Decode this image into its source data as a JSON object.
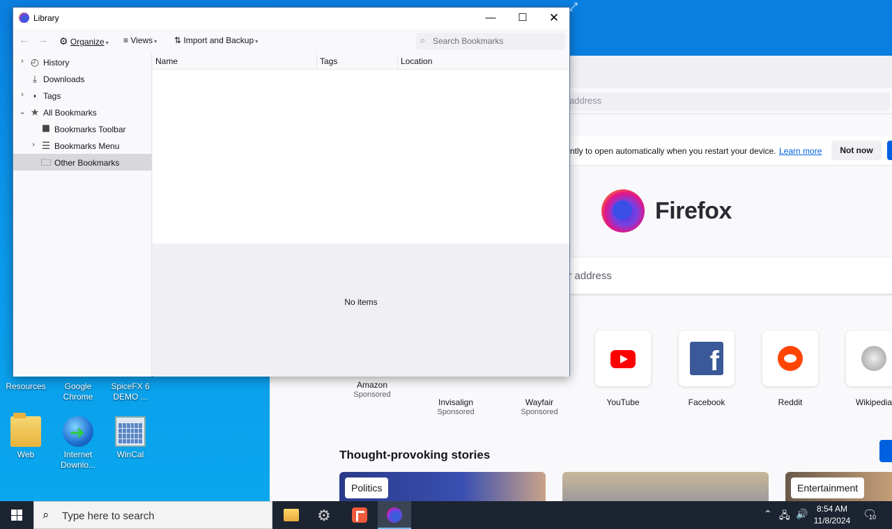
{
  "desktop": {
    "icons": [
      {
        "label": "Resources"
      },
      {
        "label": "Google Chrome"
      },
      {
        "label": "SpiceFX 6 DEMO ..."
      },
      {
        "label": "Web"
      },
      {
        "label": "Internet Downlo..."
      },
      {
        "label": "WinCal"
      }
    ]
  },
  "firefox": {
    "url_placeholder": "address",
    "notice": {
      "message": "ntly to open automatically when you restart your device.",
      "learn_more": "Learn more",
      "not_now": "Not now"
    },
    "wordmark": "Firefox",
    "search_placeholder": "er address",
    "shortcuts": [
      {
        "label": "Amazon",
        "sponsored": "Sponsored"
      },
      {
        "label": "Invisalign",
        "sponsored": "Sponsored"
      },
      {
        "label": "Wayfair",
        "sponsored": "Sponsored"
      },
      {
        "label": "YouTube",
        "icon": "youtube-icon"
      },
      {
        "label": "Facebook",
        "icon": "facebook-icon"
      },
      {
        "label": "Reddit",
        "icon": "reddit-icon"
      },
      {
        "label": "Wikipedia",
        "icon": "wikipedia-icon"
      }
    ],
    "stories_title": "Thought-provoking stories",
    "stories": [
      {
        "tag": "Politics"
      },
      {
        "tag": "Entertainment"
      }
    ]
  },
  "library": {
    "title": "Library",
    "toolbar": {
      "organize": "Organize",
      "views": "Views",
      "import_backup": "Import and Backup",
      "search_placeholder": "Search Bookmarks"
    },
    "tree": [
      {
        "label": "History",
        "icon": "clock-icon",
        "expander": "collapsed"
      },
      {
        "label": "Downloads",
        "icon": "download-icon",
        "expander": "none"
      },
      {
        "label": "Tags",
        "icon": "tag-icon",
        "expander": "collapsed"
      },
      {
        "label": "All Bookmarks",
        "icon": "star-icon",
        "expander": "expanded"
      },
      {
        "label": "Bookmarks Toolbar",
        "icon": "bookmarks-toolbar-icon",
        "expander": "none"
      },
      {
        "label": "Bookmarks Menu",
        "icon": "bookmarks-menu-icon",
        "expander": "collapsed"
      },
      {
        "label": "Other Bookmarks",
        "icon": "folder-icon",
        "expander": "none",
        "selected": true
      }
    ],
    "columns": [
      "Name",
      "Tags",
      "Location"
    ],
    "empty_text": "No items"
  },
  "taskbar": {
    "search_placeholder": "Type here to search",
    "time": "8:54 AM",
    "date": "11/8/2024",
    "notification_count": "10"
  }
}
